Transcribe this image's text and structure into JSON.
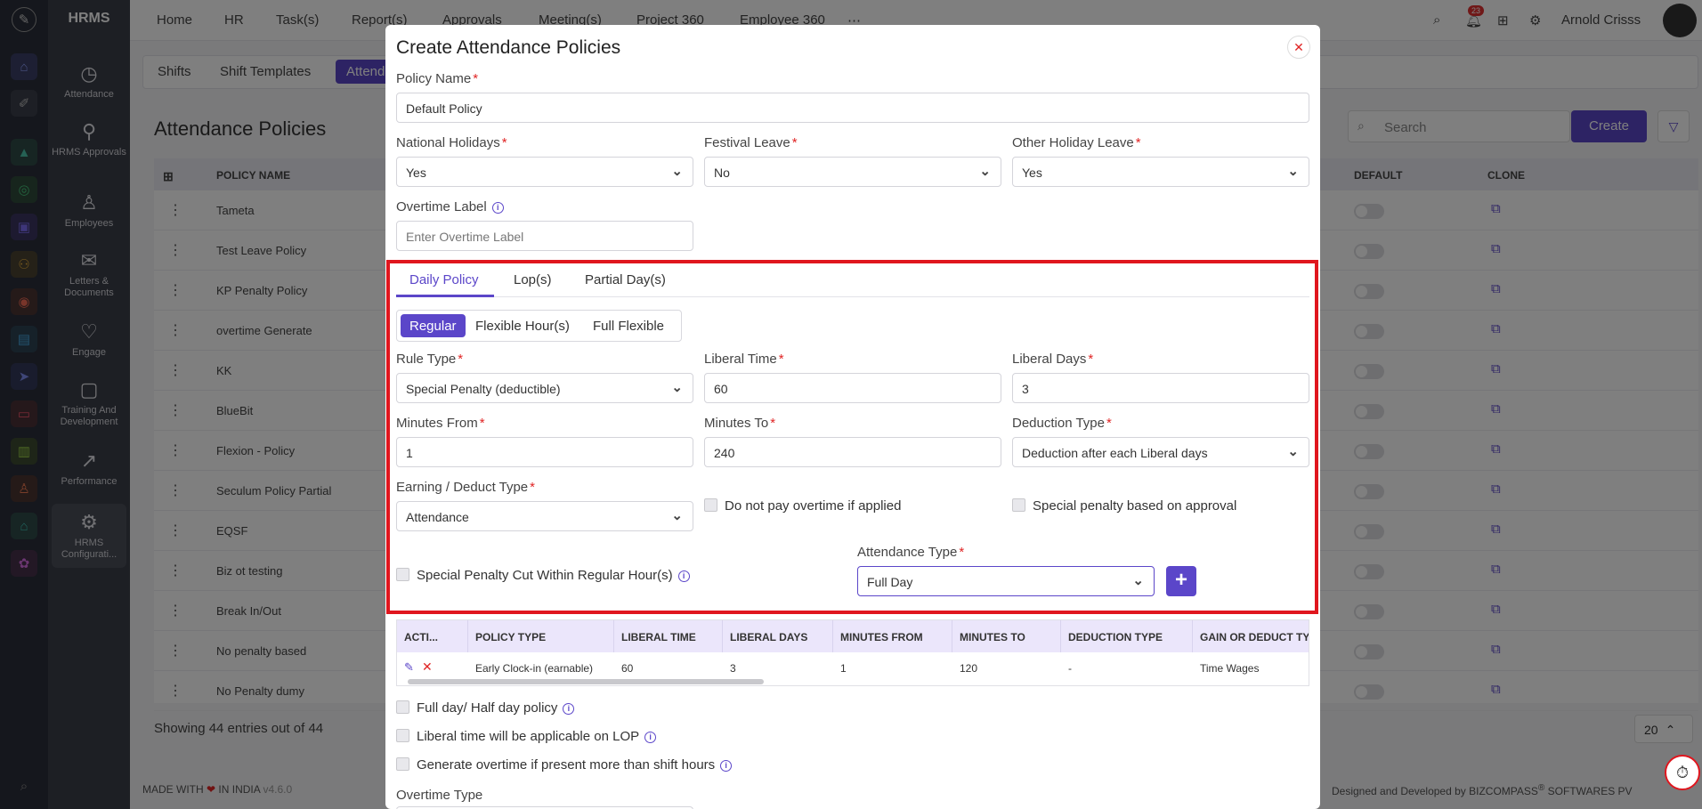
{
  "app": {
    "brand": "HRMS",
    "user_name": "Arnold Crisss",
    "notification_count": "23"
  },
  "top_nav": [
    "Home",
    "HR",
    "Task(s)",
    "Report(s)",
    "Approvals",
    "Meeting(s)",
    "Project 360",
    "Employee 360"
  ],
  "sidebar": [
    {
      "label": "Attendance",
      "icon": "attendance-icon"
    },
    {
      "label": "HRMS Approvals",
      "icon": "approvals-icon"
    },
    {
      "label": "Employees",
      "icon": "employees-icon"
    },
    {
      "label": "Letters & Documents",
      "icon": "letters-icon"
    },
    {
      "label": "Engage",
      "icon": "engage-icon"
    },
    {
      "label": "Training And Development",
      "icon": "training-icon"
    },
    {
      "label": "Performance",
      "icon": "performance-icon"
    },
    {
      "label": "HRMS Configurati...",
      "icon": "settings-icon"
    }
  ],
  "sub_tabs": [
    "Shifts",
    "Shift Templates",
    "Attend"
  ],
  "background": {
    "title": "Attendance Policies",
    "search_placeholder": "Search",
    "create_label": "Create",
    "columns": [
      "POLICY NAME",
      "DEFAULT",
      "CLONE"
    ],
    "rows": [
      "Tameta",
      "Test Leave Policy",
      "KP Penalty Policy",
      "overtime Generate",
      "KK",
      "BlueBit",
      "Flexion - Policy",
      "Seculum Policy Partial",
      "EQSF",
      "Biz ot testing",
      "Break In/Out",
      "No penalty based",
      "No Penalty dumy"
    ],
    "footer": "Showing 44 entries out of 44",
    "page_size": "20",
    "made_with": "MADE WITH",
    "in_india": "IN INDIA",
    "version": "v4.6.0",
    "designed_by": "Designed and Developed by",
    "company": "BIZCOMPASS",
    "company_suffix": "SOFTWARES PV"
  },
  "modal": {
    "title": "Create Attendance Policies",
    "policy_name_label": "Policy Name",
    "policy_name_value": "Default Policy",
    "national_holidays_label": "National Holidays",
    "national_holidays_value": "Yes",
    "festival_leave_label": "Festival Leave",
    "festival_leave_value": "No",
    "other_holiday_label": "Other Holiday Leave",
    "other_holiday_value": "Yes",
    "overtime_label_label": "Overtime Label",
    "overtime_label_placeholder": "Enter Overtime Label",
    "tabs": [
      "Daily Policy",
      "Lop(s)",
      "Partial Day(s)"
    ],
    "segments": [
      "Regular",
      "Flexible Hour(s)",
      "Full Flexible"
    ],
    "rule_type_label": "Rule Type",
    "rule_type_value": "Special Penalty (deductible)",
    "liberal_time_label": "Liberal Time",
    "liberal_time_value": "60",
    "liberal_days_label": "Liberal Days",
    "liberal_days_value": "3",
    "minutes_from_label": "Minutes From",
    "minutes_from_value": "1",
    "minutes_to_label": "Minutes To",
    "minutes_to_value": "240",
    "deduction_type_label": "Deduction Type",
    "deduction_type_value": "Deduction after each Liberal days",
    "earning_type_label": "Earning / Deduct Type",
    "earning_type_value": "Attendance",
    "no_overtime_label": "Do not pay overtime if applied",
    "special_approval_label": "Special penalty based on approval",
    "special_cut_label": "Special Penalty Cut Within Regular Hour(s)",
    "attendance_type_label": "Attendance Type",
    "attendance_type_value": "Full Day",
    "table_columns": [
      "ACTI...",
      "POLICY TYPE",
      "LIBERAL TIME",
      "LIBERAL DAYS",
      "MINUTES FROM",
      "MINUTES TO",
      "DEDUCTION TYPE",
      "GAIN OR DEDUCT TYPE"
    ],
    "table_row": [
      "Early Clock-in (earnable)",
      "60",
      "3",
      "1",
      "120",
      "-",
      "Time Wages"
    ],
    "full_half_label": "Full day/ Half day policy",
    "liberal_lop_label": "Liberal time will be applicable on LOP",
    "generate_ot_label": "Generate overtime if present more than shift hours",
    "overtime_type_label": "Overtime Type"
  },
  "colors": {
    "accent": "#5b46c9",
    "highlight": "#e0161e"
  }
}
